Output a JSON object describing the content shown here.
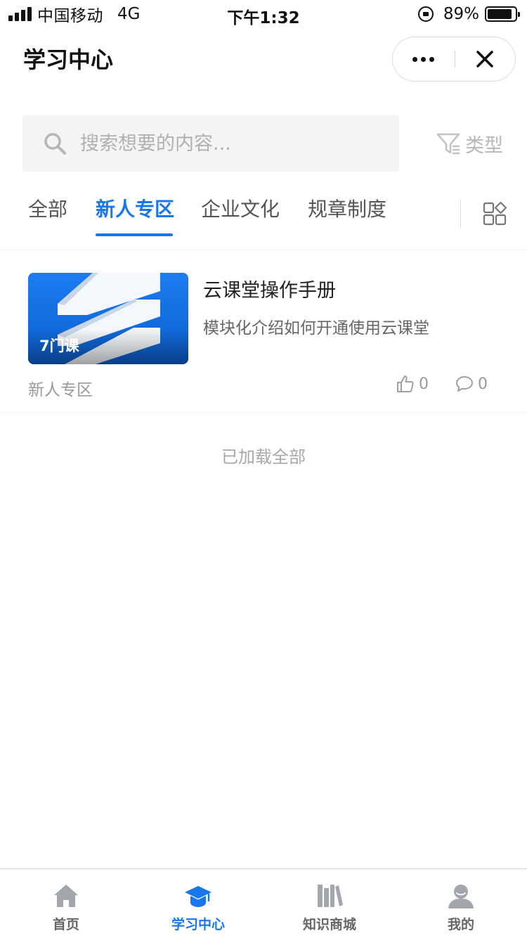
{
  "status_bar": {
    "carrier": "中国移动",
    "network": "4G",
    "time": "下午1:32",
    "battery_percent": "89%",
    "battery_level": 0.89
  },
  "nav": {
    "title": "学习中心",
    "more_icon": "more-dots-icon",
    "close_icon": "close-icon"
  },
  "search": {
    "placeholder": "搜索想要的内容...",
    "value": "",
    "type_filter_label": "类型"
  },
  "tabs": [
    {
      "label": "全部",
      "active": false
    },
    {
      "label": "新人专区",
      "active": true
    },
    {
      "label": "企业文化",
      "active": false
    },
    {
      "label": "规章制度",
      "active": false
    }
  ],
  "courses": [
    {
      "title": "云课堂操作手册",
      "description": "模块化介绍如何开通使用云课堂",
      "course_count": "7门课",
      "category": "新人专区",
      "likes": "0",
      "comments": "0"
    }
  ],
  "list_footer": "已加载全部",
  "tab_bar": [
    {
      "label": "首页",
      "icon": "home-icon",
      "active": false
    },
    {
      "label": "学习中心",
      "icon": "graduation-cap-icon",
      "active": true
    },
    {
      "label": "知识商城",
      "icon": "books-icon",
      "active": false
    },
    {
      "label": "我的",
      "icon": "user-icon",
      "active": false
    }
  ],
  "colors": {
    "accent": "#1977ed",
    "thumbnail": "#1875e6",
    "inactive_icon": "#9aa0a6"
  }
}
